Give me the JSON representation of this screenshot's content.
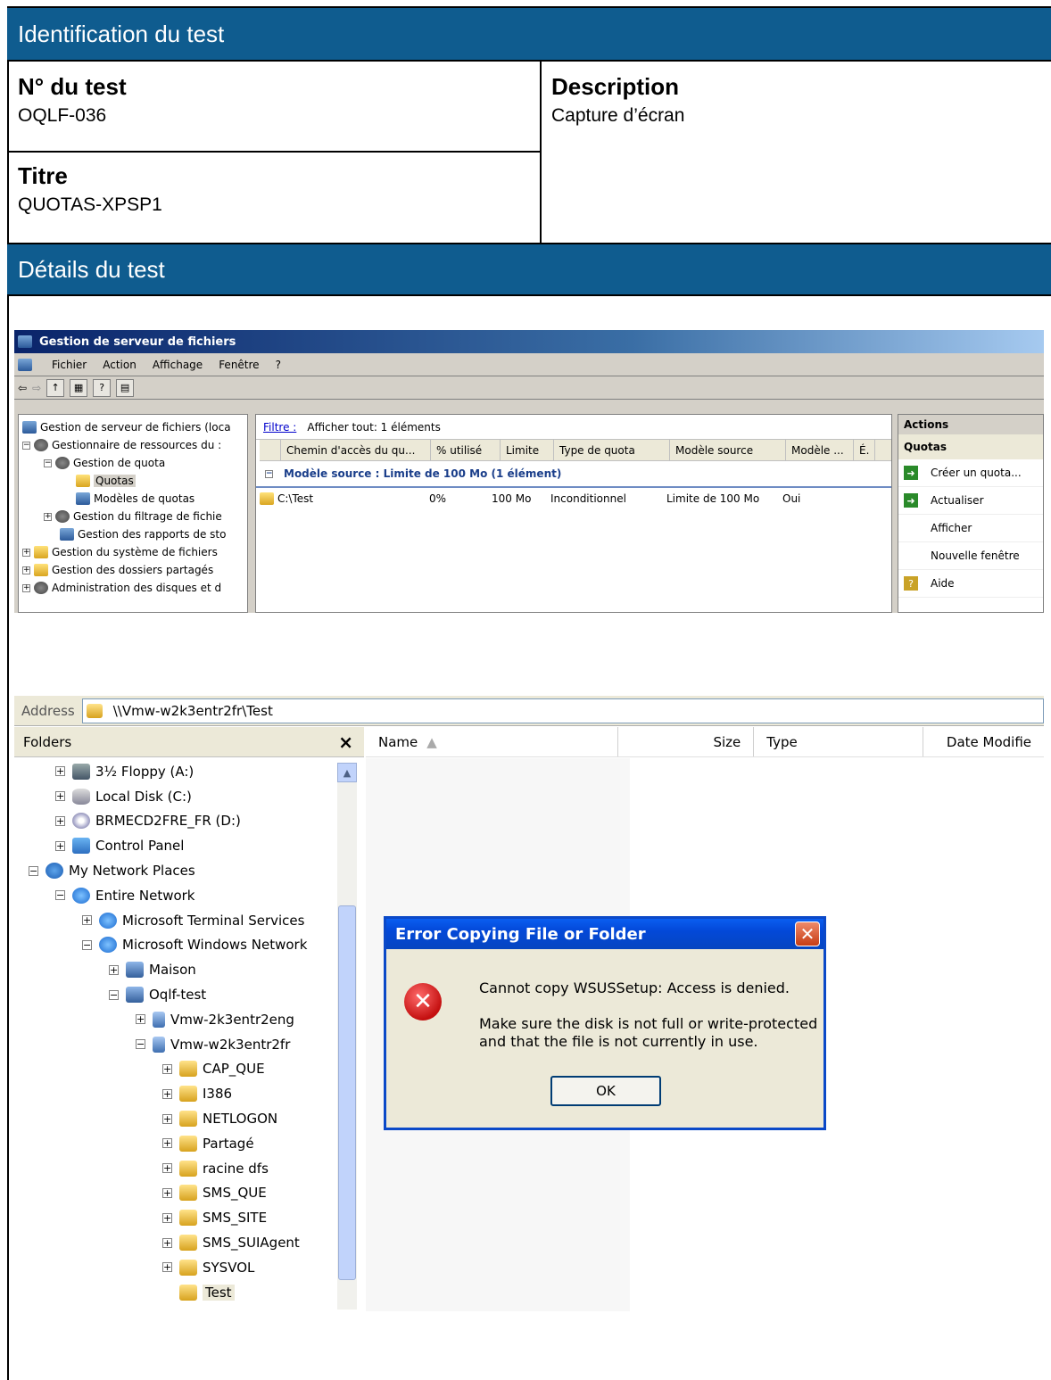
{
  "doc": {
    "section1_title": "Identification du test",
    "test_no_label": "N° du test",
    "test_no_value": "OQLF-036",
    "description_label": "Description",
    "description_value": "Capture d’écran",
    "title_label": "Titre",
    "title_value": "QUOTAS-XPSP1",
    "section2_title": "Détails du test"
  },
  "mmc": {
    "window_title": "Gestion de serveur de fichiers",
    "menu": [
      "Fichier",
      "Action",
      "Affichage",
      "Fenêtre",
      "?"
    ],
    "tree": [
      "Gestion de serveur de fichiers (loca",
      "Gestionnaire de ressources du :",
      "Gestion de quota",
      "Quotas",
      "Modèles de quotas",
      "Gestion du filtrage de fichie",
      "Gestion des rapports de sto",
      "Gestion du système de fichiers",
      "Gestion des dossiers partagés",
      "Administration des disques et d"
    ],
    "filter_link": "Filtre :",
    "filter_text": "Afficher tout: 1 éléments",
    "columns": [
      "Chemin d'accès du qu...",
      "% utilisé",
      "Limite",
      "Type de quota",
      "Modèle source",
      "Modèle ...",
      "É."
    ],
    "group_label": "Modèle source : Limite de 100 Mo (1 élément)",
    "row": [
      "C:\\Test",
      "0%",
      "100 Mo",
      "Inconditionnel",
      "Limite de 100 Mo",
      "Oui"
    ],
    "actions_header": "Actions",
    "actions_section": "Quotas",
    "actions": [
      "Créer un quota...",
      "Actualiser",
      "Afficher",
      "Nouvelle fenêtre",
      "Aide"
    ]
  },
  "explorer": {
    "address_label": "Address",
    "address_value": "\\\\Vmw-w2k3entr2fr\\Test",
    "folders_label": "Folders",
    "close_glyph": "×",
    "columns": [
      "Name",
      "Size",
      "Type",
      "Date Modifie"
    ],
    "tree": [
      "3½ Floppy (A:)",
      "Local Disk (C:)",
      "BRMECD2FRE_FR (D:)",
      "Control Panel",
      "My Network Places",
      "Entire Network",
      "Microsoft Terminal Services",
      "Microsoft Windows Network",
      "Maison",
      "Oqlf-test",
      "Vmw-2k3entr2eng",
      "Vmw-w2k3entr2fr",
      "CAP_QUE",
      "I386",
      "NETLOGON",
      "Partagé",
      "racine dfs",
      "SMS_QUE",
      "SMS_SITE",
      "SMS_SUIAgent",
      "SYSVOL",
      "Test"
    ]
  },
  "dialog": {
    "title": "Error Copying File or Folder",
    "message1": "Cannot copy WSUSSetup: Access is denied.",
    "message2": "Make sure the disk is not full or write-protected and that the file is not currently in use.",
    "ok_label": "OK"
  }
}
